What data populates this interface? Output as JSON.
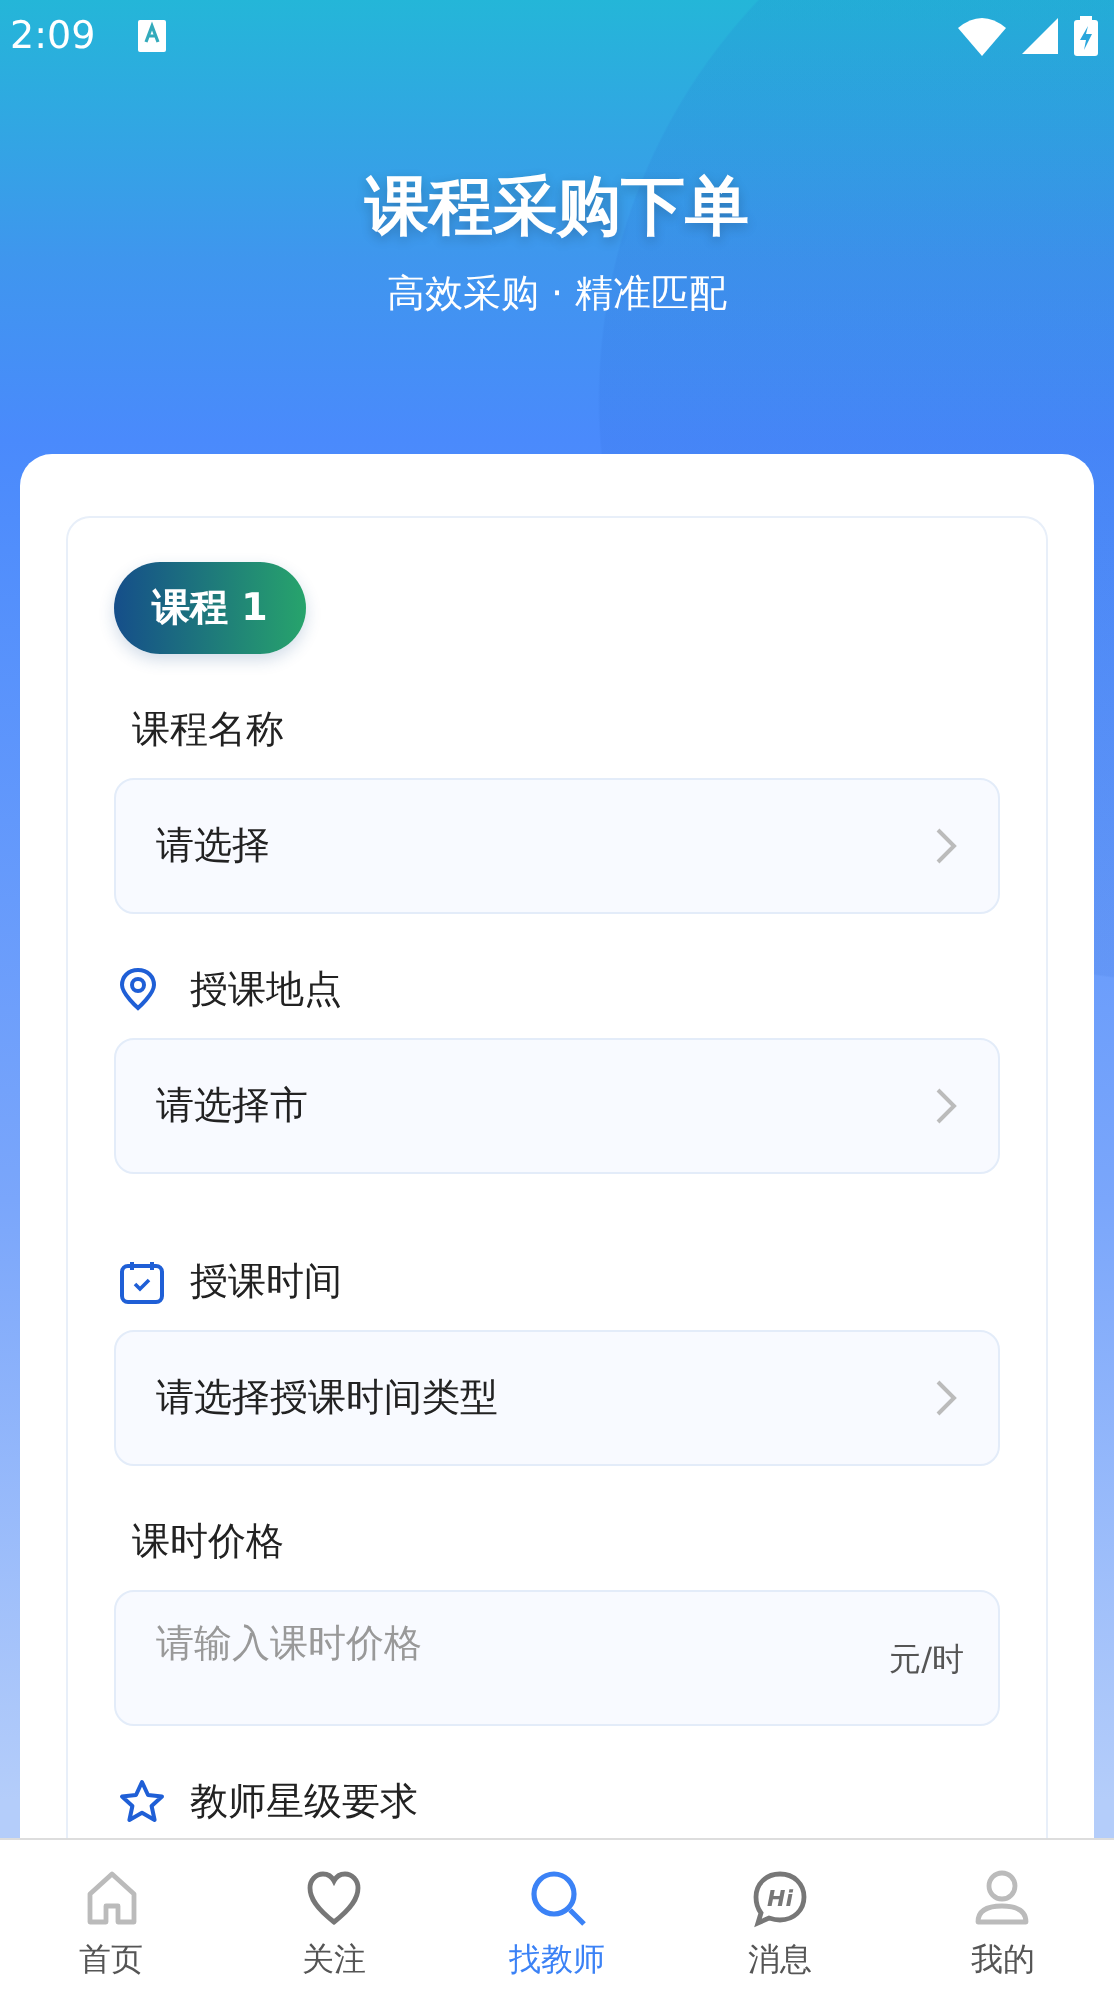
{
  "status_bar": {
    "time": "2:09"
  },
  "header": {
    "title": "课程采购下单",
    "subtitle": "高效采购 · 精准匹配"
  },
  "course": {
    "badge": "课程 1",
    "sections": [
      {
        "label": "课程名称",
        "kind": "plain",
        "field": {
          "kind": "select",
          "placeholder": "请选择"
        }
      },
      {
        "label": "授课地点",
        "kind": "location",
        "field": {
          "kind": "select",
          "placeholder": "请选择市"
        }
      },
      {
        "label": "授课时间",
        "kind": "time",
        "field": {
          "kind": "select",
          "placeholder": "请选择授课时间类型"
        }
      },
      {
        "label": "课时价格",
        "kind": "plain",
        "field": {
          "kind": "input",
          "placeholder": "请输入课时价格",
          "unit": "元/时"
        }
      },
      {
        "label": "教师星级要求",
        "kind": "rating"
      }
    ]
  },
  "bottom_nav": [
    {
      "label": "首页",
      "selected": false
    },
    {
      "label": "关注",
      "selected": false
    },
    {
      "label": "找教师",
      "selected": true
    },
    {
      "label": "消息",
      "icon_text": "Hi",
      "selected": false
    },
    {
      "label": "我的",
      "selected": false
    }
  ]
}
